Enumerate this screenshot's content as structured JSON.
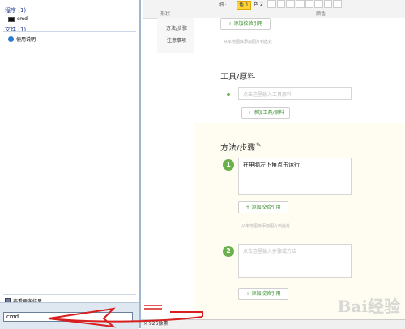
{
  "ribbon": {
    "shape_label": "形状",
    "color_label": "颜色",
    "thin_label": "细 ·",
    "color1": "色 1",
    "color2": "色 2"
  },
  "left_nav": {
    "items": [
      "方法/步骤",
      "注意事项"
    ]
  },
  "editor": {
    "add_citation": "+ 添加校验引用",
    "upload_note": "从本地图库添加图片到此处",
    "tools_title": "工具/原料",
    "tools_placeholder": "点击这里输入工具原料",
    "add_tools": "+ 添加工具/原料",
    "steps_title": "方法/步骤",
    "steps": [
      {
        "num": "1",
        "text": "在电脑左下角点击运行",
        "add_citation": "+ 添加校验引用",
        "upload_note": "从本地图库添加图片到此处"
      },
      {
        "num": "2",
        "placeholder": "点击这里输入步骤或方法",
        "add_citation": "+ 添加校验引用"
      }
    ]
  },
  "start_menu": {
    "programs_header": "程序 (1)",
    "program_item": "cmd",
    "files_header": "文件 (1)",
    "file_item": "使用说明",
    "see_more": "查看更多结果",
    "search_value": "cmd"
  },
  "status": {
    "size_text": "× 926像素"
  },
  "annotation": {
    "arrow_color": "#d81e1e"
  },
  "watermark": "Bai经验",
  "colors": {
    "accent_green": "#6ab04c",
    "yellow_swatch": "#ffd43b"
  }
}
